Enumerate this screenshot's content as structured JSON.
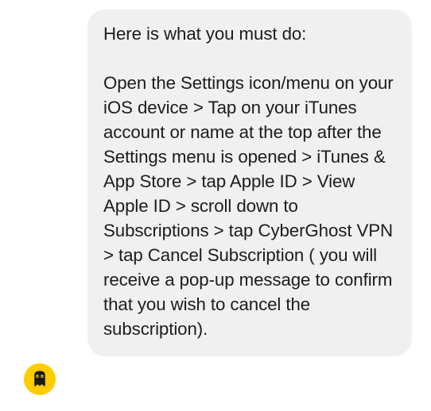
{
  "message": {
    "sender_avatar_icon": "cyberghost-logo",
    "text": "Here is what you must do:\n\nOpen the Settings icon/menu on your iOS device > Tap on your iTunes account or name at the top after the Settings menu is opened > iTunes & App Store > tap Apple ID > View Apple ID > scroll down to Subscriptions > tap CyberGhost VPN > tap Cancel Subscription ( you will receive a pop-up message to confirm that you wish to cancel the subscription)."
  },
  "colors": {
    "avatar_bg": "#ffcc00",
    "bubble_bg": "#f0f0f1",
    "text": "#1c1c1e"
  }
}
